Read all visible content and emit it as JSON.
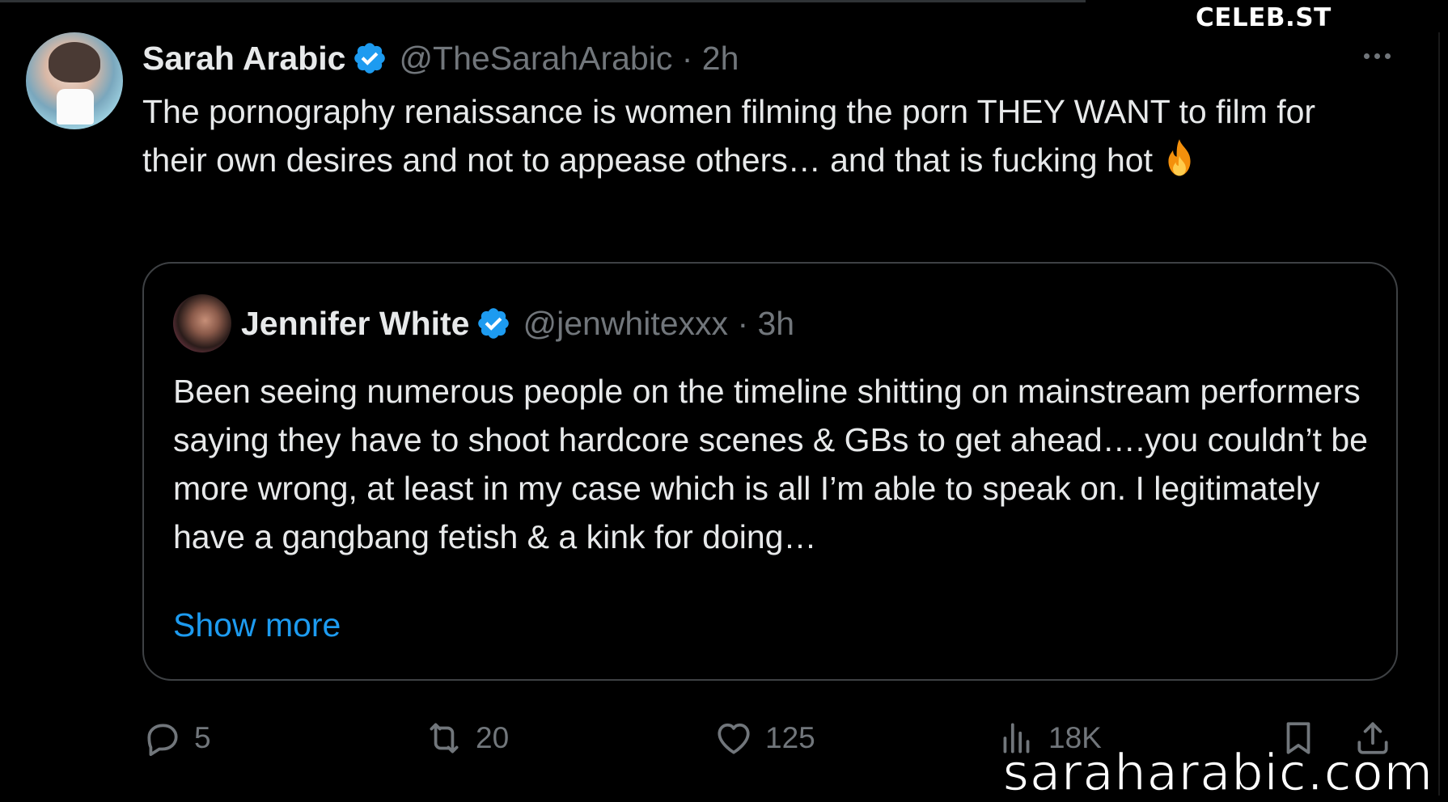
{
  "watermark": {
    "top": "CELEB.ST",
    "bottom": "saraharabic.com"
  },
  "tweet": {
    "author_name": "Sarah Arabic",
    "handle": "@TheSarahArabic",
    "time": "2h",
    "text": "The pornography renaissance is women filming the porn THEY WANT to film for their own desires and not to appease others… and that is fucking hot",
    "emoji_icon": "fire-icon"
  },
  "quote": {
    "author_name": "Jennifer White",
    "handle": "@jenwhitexxx",
    "time": "3h",
    "text": "Been seeing numerous people on the timeline shitting on mainstream performers saying they have to shoot hardcore scenes & GBs to get ahead….you couldn’t be more wrong, at least in my case which is all I’m able to speak on. I legitimately have a gangbang fetish & a kink for doing…",
    "show_more": "Show more"
  },
  "actions": {
    "replies": "5",
    "reposts": "20",
    "likes": "125",
    "views": "18K"
  },
  "colors": {
    "background": "#000000",
    "text": "#e7e9ea",
    "muted": "#71767b",
    "accent": "#1d9bf0",
    "border": "#3e4144"
  }
}
